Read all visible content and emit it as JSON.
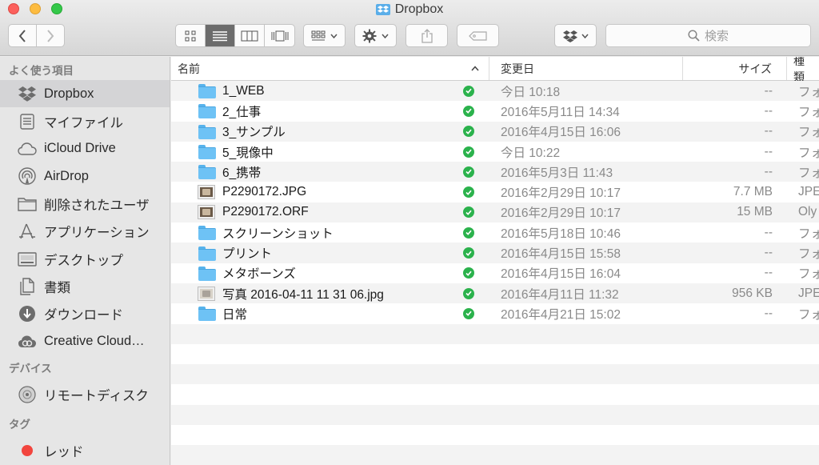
{
  "window": {
    "title": "Dropbox"
  },
  "toolbar": {
    "search_placeholder": "検索"
  },
  "sidebar": {
    "favorites_header": "よく使う項目",
    "favorites": [
      {
        "label": "Dropbox",
        "icon": "dropbox-icon",
        "active": true
      },
      {
        "label": "マイファイル",
        "icon": "all-my-files-icon"
      },
      {
        "label": "iCloud Drive",
        "icon": "cloud-icon"
      },
      {
        "label": "AirDrop",
        "icon": "airdrop-icon"
      },
      {
        "label": "削除されたユーザ",
        "icon": "folder-icon"
      },
      {
        "label": "アプリケーション",
        "icon": "applications-icon"
      },
      {
        "label": "デスクトップ",
        "icon": "desktop-icon"
      },
      {
        "label": "書類",
        "icon": "documents-icon"
      },
      {
        "label": "ダウンロード",
        "icon": "downloads-icon"
      },
      {
        "label": "Creative Cloud…",
        "icon": "creative-cloud-icon"
      }
    ],
    "devices_header": "デバイス",
    "devices": [
      {
        "label": "リモートディスク",
        "icon": "remote-disc-icon"
      }
    ],
    "tags_header": "タグ",
    "tags": [
      {
        "label": "レッド",
        "icon": "tag-red-icon",
        "color": "#f2453e"
      }
    ]
  },
  "columns": {
    "name": "名前",
    "date": "変更日",
    "size": "サイズ",
    "kind": "種類"
  },
  "files": [
    {
      "name": "1_WEB",
      "type": "folder",
      "date": "今日 10:18",
      "size": "--",
      "kind": "フォ"
    },
    {
      "name": "2_仕事",
      "type": "folder",
      "date": "2016年5月11日 14:34",
      "size": "--",
      "kind": "フォ"
    },
    {
      "name": "3_サンプル",
      "type": "folder",
      "date": "2016年4月15日 16:06",
      "size": "--",
      "kind": "フォ"
    },
    {
      "name": "5_現像中",
      "type": "folder",
      "date": "今日 10:22",
      "size": "--",
      "kind": "フォ"
    },
    {
      "name": "6_携帯",
      "type": "folder",
      "date": "2016年5月3日 11:43",
      "size": "--",
      "kind": "フォ"
    },
    {
      "name": "P2290172.JPG",
      "type": "image",
      "date": "2016年2月29日 10:17",
      "size": "7.7 MB",
      "kind": "JPE"
    },
    {
      "name": "P2290172.ORF",
      "type": "image",
      "date": "2016年2月29日 10:17",
      "size": "15 MB",
      "kind": "Oly"
    },
    {
      "name": "スクリーンショット",
      "type": "folder",
      "date": "2016年5月18日 10:46",
      "size": "--",
      "kind": "フォ"
    },
    {
      "name": "プリント",
      "type": "folder",
      "date": "2016年4月15日 15:58",
      "size": "--",
      "kind": "フォ"
    },
    {
      "name": "メタボーンズ",
      "type": "folder",
      "date": "2016年4月15日 16:04",
      "size": "--",
      "kind": "フォ"
    },
    {
      "name": "写真 2016-04-11 11 31 06.jpg",
      "type": "image-light",
      "date": "2016年4月11日 11:32",
      "size": "956 KB",
      "kind": "JPE"
    },
    {
      "name": "日常",
      "type": "folder",
      "date": "2016年4月21日 15:02",
      "size": "--",
      "kind": "フォ"
    }
  ],
  "colors": {
    "sync_check": "#2bb24c",
    "folder_blue": "#6ec2f5"
  }
}
